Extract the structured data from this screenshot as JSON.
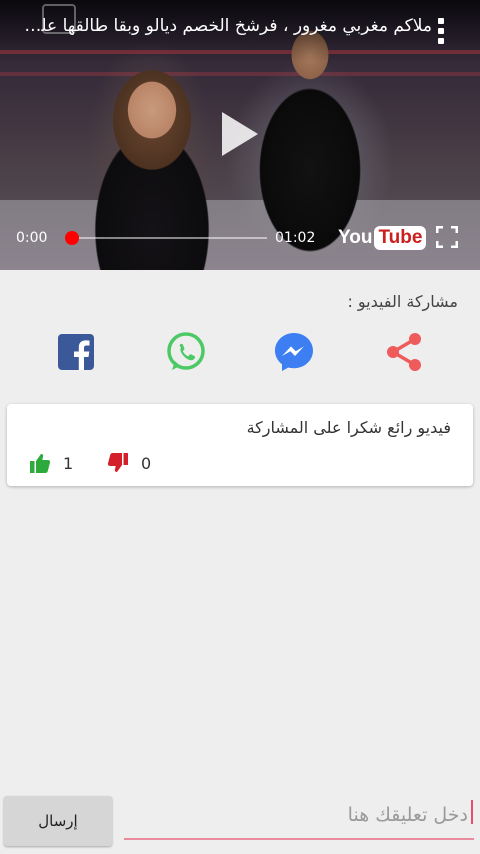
{
  "video": {
    "title": "ملاكم مغربي مغرور ، فرشخ الخصم ديالو وبقا طالقها علي...",
    "current_time": "0:00",
    "duration": "01:02",
    "progress": 0,
    "logo_text_you": "You",
    "logo_text_tube": "Tube",
    "more_icon": "more-vert-icon",
    "play_icon": "play-icon",
    "fullscreen_icon": "fullscreen-icon"
  },
  "share": {
    "title": "مشاركة الفيديو :",
    "buttons": [
      {
        "name": "facebook",
        "icon": "facebook-icon",
        "color": "#3b5998"
      },
      {
        "name": "whatsapp",
        "icon": "whatsapp-icon",
        "color": "#4cc964"
      },
      {
        "name": "messenger",
        "icon": "messenger-icon",
        "color": "#3d7ff2"
      },
      {
        "name": "share",
        "icon": "share-icon",
        "color": "#ef5a5a"
      }
    ]
  },
  "comments": [
    {
      "text": "فيديو رائع شكرا على المشاركة",
      "likes": "1",
      "dislikes": "0",
      "like_color": "#2eaa3c",
      "dislike_color": "#d3202a"
    }
  ],
  "composer": {
    "placeholder": "دخل تعليقك هنا",
    "value": "",
    "send_label": "إرسال",
    "underline_color": "#e98b9d"
  }
}
